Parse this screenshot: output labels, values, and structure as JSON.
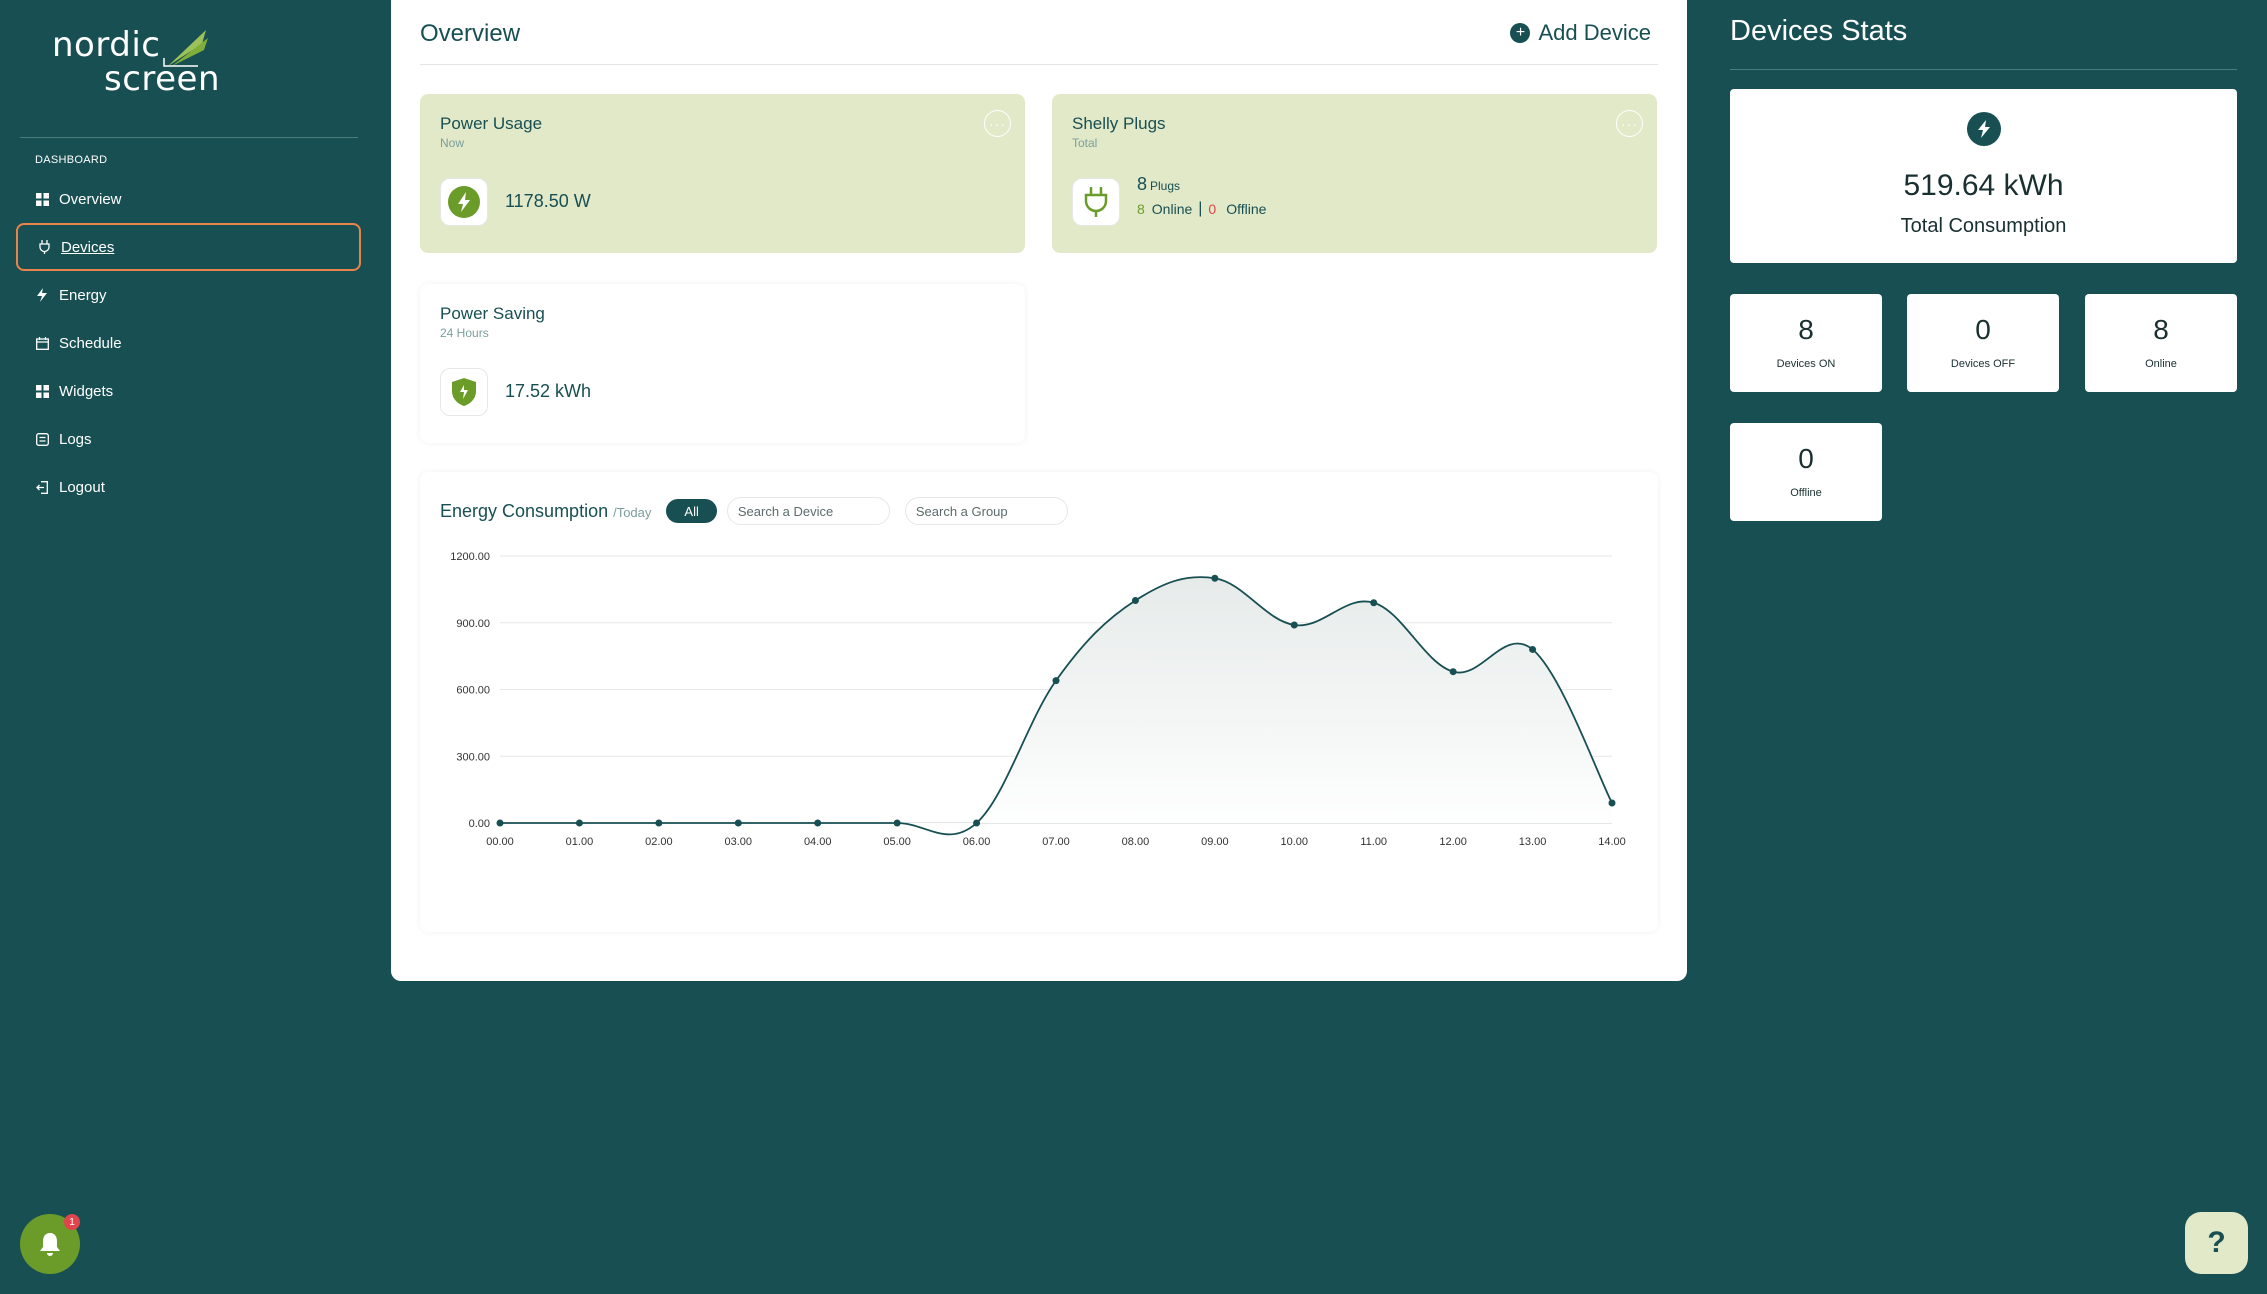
{
  "sidebar": {
    "logo_line1": "nordic",
    "logo_line2": "screen",
    "section_label": "DASHBOARD",
    "items": [
      {
        "label": "Overview",
        "icon": "grid-icon"
      },
      {
        "label": "Devices",
        "icon": "plug-icon"
      },
      {
        "label": "Energy",
        "icon": "bolt-icon"
      },
      {
        "label": "Schedule",
        "icon": "calendar-icon"
      },
      {
        "label": "Widgets",
        "icon": "widgets-icon"
      },
      {
        "label": "Logs",
        "icon": "logs-icon"
      },
      {
        "label": "Logout",
        "icon": "logout-icon"
      }
    ],
    "active_item": "Devices"
  },
  "main": {
    "title": "Overview",
    "add_device_label": "Add Device",
    "power_usage": {
      "title": "Power Usage",
      "subtitle": "Now",
      "value": "1178.50 W",
      "menu": "···"
    },
    "shelly_plugs": {
      "title": "Shelly Plugs",
      "subtitle": "Total",
      "count": "8",
      "count_unit": "Plugs",
      "online_count": "8",
      "online_label": "Online",
      "separator": "|",
      "offline_count": "0",
      "offline_label": "Offline",
      "menu": "···"
    },
    "power_saving": {
      "title": "Power Saving",
      "subtitle": "24 Hours",
      "value": "17.52 kWh"
    },
    "energy": {
      "title": "Energy Consumption",
      "period": "/Today",
      "filter_all": "All",
      "search_device_placeholder": "Search a Device",
      "search_group_placeholder": "Search a Group"
    }
  },
  "chart_data": {
    "type": "area",
    "x": [
      "00.00",
      "01.00",
      "02.00",
      "03.00",
      "04.00",
      "05.00",
      "06.00",
      "07.00",
      "08.00",
      "09.00",
      "10.00",
      "11.00",
      "12.00",
      "13.00",
      "14.00"
    ],
    "series": [
      {
        "name": "All",
        "values": [
          0,
          0,
          0,
          0,
          0,
          0,
          0,
          640,
          1000,
          1100,
          890,
          990,
          680,
          780,
          90
        ]
      }
    ],
    "yticks": [
      "0.00",
      "300.00",
      "600.00",
      "900.00",
      "1200.00"
    ],
    "ylim": [
      0,
      1200
    ],
    "legend": "bottom-center",
    "grid": true
  },
  "stats": {
    "title": "Devices Stats",
    "total_value": "519.64 kWh",
    "total_label": "Total Consumption",
    "cards": [
      {
        "value": "8",
        "label": "Devices ON"
      },
      {
        "value": "0",
        "label": "Devices OFF"
      },
      {
        "value": "8",
        "label": "Online"
      },
      {
        "value": "0",
        "label": "Offline"
      }
    ]
  },
  "notifications": {
    "badge": "1"
  },
  "help": {
    "label": "?"
  },
  "colors": {
    "bg": "#184f52",
    "accent_green": "#6b9c2a",
    "card_green": "#e1e9c8",
    "offline_red": "#e0454d",
    "active_outline": "#e8834b"
  }
}
